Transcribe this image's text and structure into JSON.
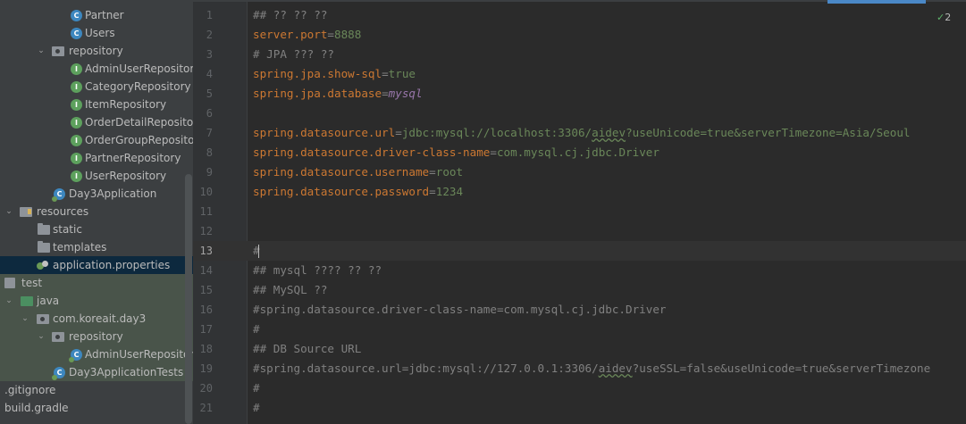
{
  "project_tree": {
    "items": [
      {
        "label": "Partner",
        "icon": "class-icon",
        "type": "class",
        "indent": 1
      },
      {
        "label": "Users",
        "icon": "class-icon",
        "type": "class",
        "indent": 1
      },
      {
        "label": "repository",
        "icon": "package-icon",
        "type": "package",
        "expanded": true
      },
      {
        "label": "AdminUserRepository",
        "icon": "interface-icon",
        "type": "interface"
      },
      {
        "label": "CategoryRepository",
        "icon": "interface-icon",
        "type": "interface"
      },
      {
        "label": "ItemRepository",
        "icon": "interface-icon",
        "type": "interface"
      },
      {
        "label": "OrderDetailRepository",
        "icon": "interface-icon",
        "type": "interface"
      },
      {
        "label": "OrderGroupRepository",
        "icon": "interface-icon",
        "type": "interface"
      },
      {
        "label": "PartnerRepository",
        "icon": "interface-icon",
        "type": "interface"
      },
      {
        "label": "UserRepository",
        "icon": "interface-icon",
        "type": "interface"
      },
      {
        "label": "Day3Application",
        "icon": "spring-boot-class-icon",
        "type": "app"
      },
      {
        "label": "resources",
        "icon": "resources-folder-icon",
        "type": "folder",
        "expanded": true
      },
      {
        "label": "static",
        "icon": "folder-icon",
        "type": "folder"
      },
      {
        "label": "templates",
        "icon": "folder-icon",
        "type": "folder"
      },
      {
        "label": "application.properties",
        "icon": "properties-file-icon",
        "type": "file",
        "selected": true
      },
      {
        "label": "test",
        "icon": "test-folder-icon",
        "type": "folder",
        "expanded": true
      },
      {
        "label": "java",
        "icon": "source-folder-icon",
        "type": "folder",
        "expanded": true
      },
      {
        "label": "com.koreait.day3",
        "icon": "package-icon",
        "type": "package",
        "expanded": true
      },
      {
        "label": "repository",
        "icon": "package-icon",
        "type": "package",
        "expanded": true
      },
      {
        "label": "AdminUserRepositoryT",
        "icon": "spring-boot-class-icon",
        "type": "app"
      },
      {
        "label": "Day3ApplicationTests",
        "icon": "spring-boot-class-icon",
        "type": "app"
      },
      {
        "label": ".gitignore",
        "icon": "file-icon",
        "type": "file"
      },
      {
        "label": "build.gradle",
        "icon": "gradle-file-icon",
        "type": "file"
      }
    ]
  },
  "editor": {
    "active_line": 13,
    "inspection_count": "2",
    "line_numbers": [
      "1",
      "2",
      "3",
      "4",
      "5",
      "6",
      "7",
      "8",
      "9",
      "10",
      "11",
      "12",
      "13",
      "14",
      "15",
      "16",
      "17",
      "18",
      "19",
      "20",
      "21"
    ],
    "lines": [
      {
        "kind": "comment",
        "text": "## ?? ?? ??"
      },
      {
        "kind": "prop",
        "key": "server.port",
        "value": "8888"
      },
      {
        "kind": "comment",
        "text": "# JPA ??? ??"
      },
      {
        "kind": "prop",
        "key": "spring.jpa.show-sql",
        "value": "true"
      },
      {
        "kind": "prop",
        "key": "spring.jpa.database",
        "value": "mysql",
        "italic": true
      },
      {
        "kind": "blank",
        "text": ""
      },
      {
        "kind": "prop_url",
        "key": "spring.datasource.url",
        "value_pre": "jdbc:mysql://localhost:3306/",
        "value_u": "aidev",
        "value_post": "?useUnicode=true&serverTimezone=Asia/Seoul"
      },
      {
        "kind": "prop_dotted",
        "key": "spring.datasource.driver-class-name",
        "value": "com.mysql.cj.jdbc.Driver"
      },
      {
        "kind": "prop",
        "key": "spring.datasource.username",
        "value": "root"
      },
      {
        "kind": "prop",
        "key": "spring.datasource.password",
        "value": "1234"
      },
      {
        "kind": "blank",
        "text": ""
      },
      {
        "kind": "blank",
        "text": ""
      },
      {
        "kind": "comment",
        "text": "#"
      },
      {
        "kind": "comment",
        "text": "## mysql ???? ?? ??"
      },
      {
        "kind": "comment",
        "text": "## MySQL ??"
      },
      {
        "kind": "comment",
        "text": "#spring.datasource.driver-class-name=com.mysql.cj.jdbc.Driver"
      },
      {
        "kind": "comment",
        "text": "#"
      },
      {
        "kind": "comment",
        "text": "## DB Source URL"
      },
      {
        "kind": "comment_url",
        "pre": "#spring.datasource.url=jdbc:mysql://127.0.0.1:3306/",
        "u": "aidev",
        "post": "?useSSL=false&useUnicode=true&serverTimezone"
      },
      {
        "kind": "comment",
        "text": "#"
      },
      {
        "kind": "comment",
        "text": "#"
      }
    ]
  },
  "colors": {
    "key": "#cc7832",
    "value": "#6a8759",
    "comment": "#808080",
    "selection": "#0d293e",
    "tab_indicator": "#4a88c7"
  }
}
